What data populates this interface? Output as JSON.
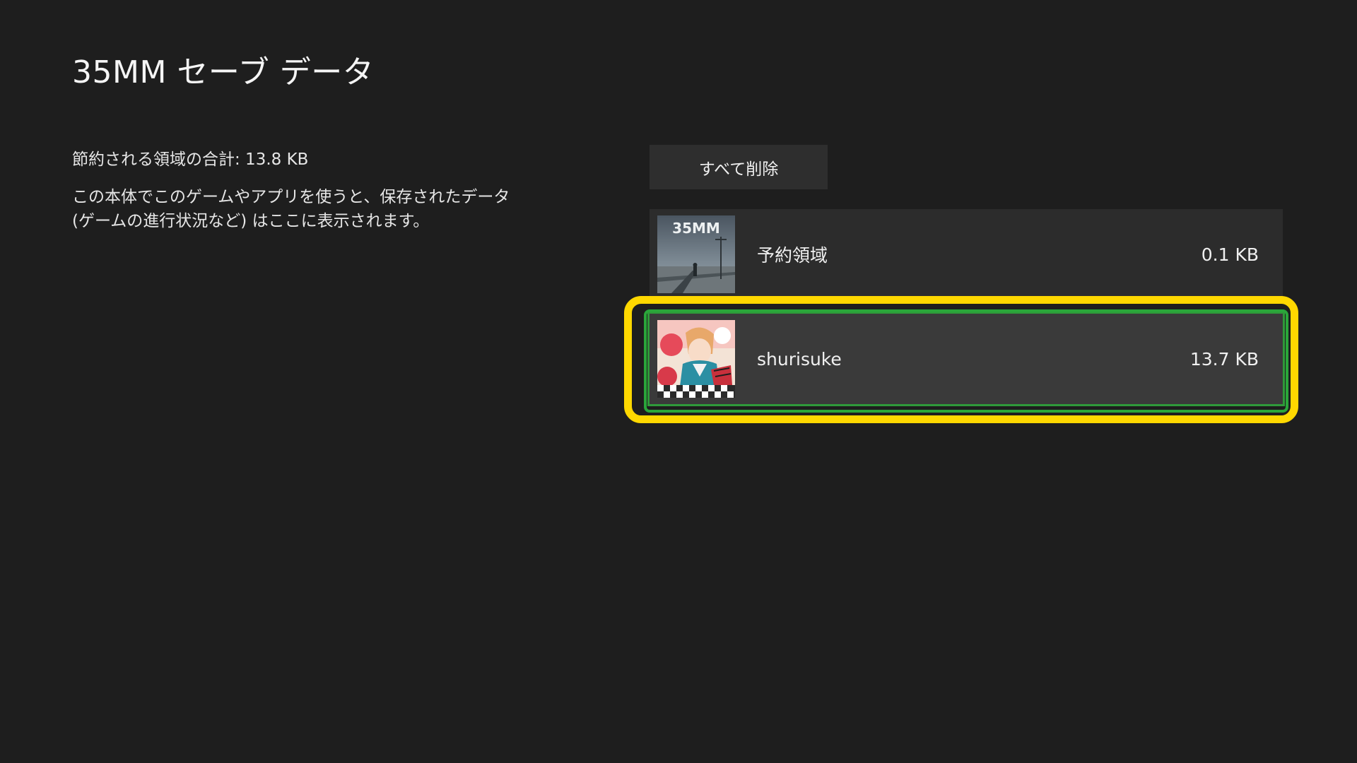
{
  "header": {
    "title": "35MM セーブ データ"
  },
  "info": {
    "total_space": "節約される領域の合計: 13.8 KB",
    "description_line1": "この本体でこのゲームやアプリを使うと、保存されたデータ",
    "description_line2": "(ゲームの進行状況など) はここに表示されます。"
  },
  "actions": {
    "delete_all_label": "すべて削除"
  },
  "save_items": [
    {
      "name": "予約領域",
      "size": "0.1 KB",
      "thumbnail_text": "35MM",
      "icon": "35mm-game-thumbnail"
    },
    {
      "name": "shurisuke",
      "size": "13.7 KB",
      "selected": true,
      "icon": "gamer-profile-picture"
    }
  ],
  "colors": {
    "background": "#1e1e1e",
    "item_background": "#2c2c2c",
    "focus_highlight": "#ffd800",
    "selection_green": "#2aa63a"
  }
}
